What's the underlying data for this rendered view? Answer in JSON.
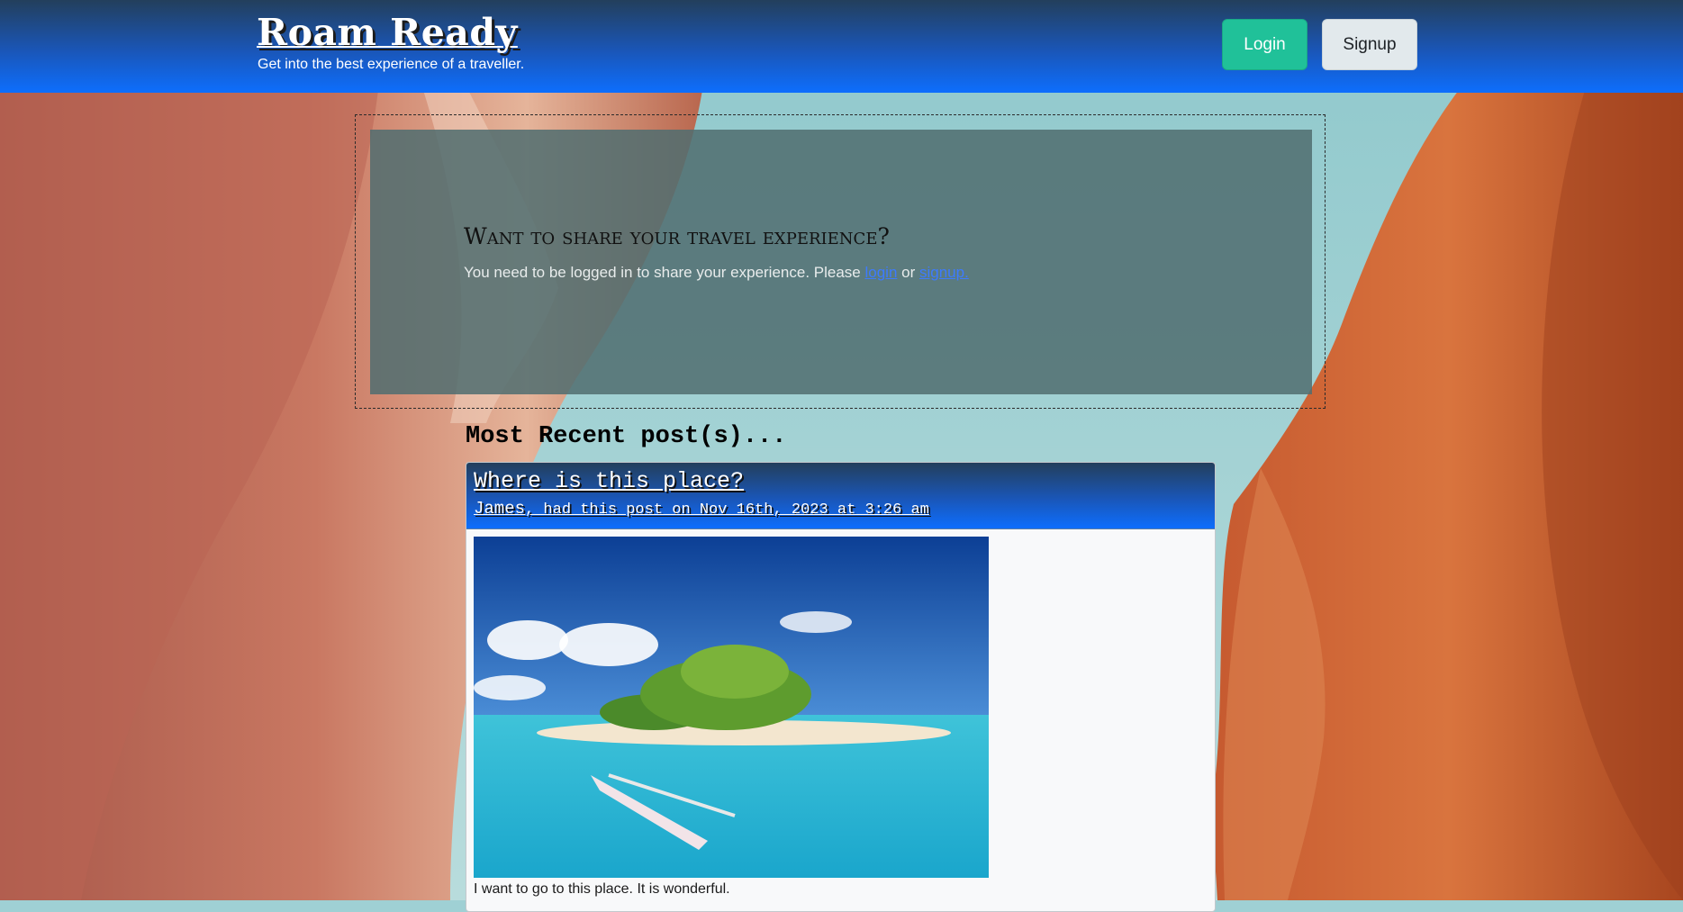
{
  "header": {
    "title": "Roam Ready",
    "tagline": "Get into the best experience of a traveller.",
    "login_label": "Login",
    "signup_label": "Signup"
  },
  "share": {
    "heading": "Want to share your travel experience?",
    "text": "You need to be logged in to share your experience. Please ",
    "login_link": "login",
    "or_text": " or ",
    "signup_link": "signup."
  },
  "recent": {
    "title": "Most Recent post(s)..."
  },
  "post": {
    "title": "Where is this place?",
    "author": "James",
    "meta": ", had this post on Nov 16th, 2023 at 3:26 am",
    "body": "I want to go to this place. It is wonderful."
  },
  "colors": {
    "header_gradient_top": "#233f5c",
    "header_gradient_bottom": "#0d6efd",
    "login_button": "#20c199",
    "signup_button": "#e2e9ec",
    "link": "#3d7bff"
  }
}
